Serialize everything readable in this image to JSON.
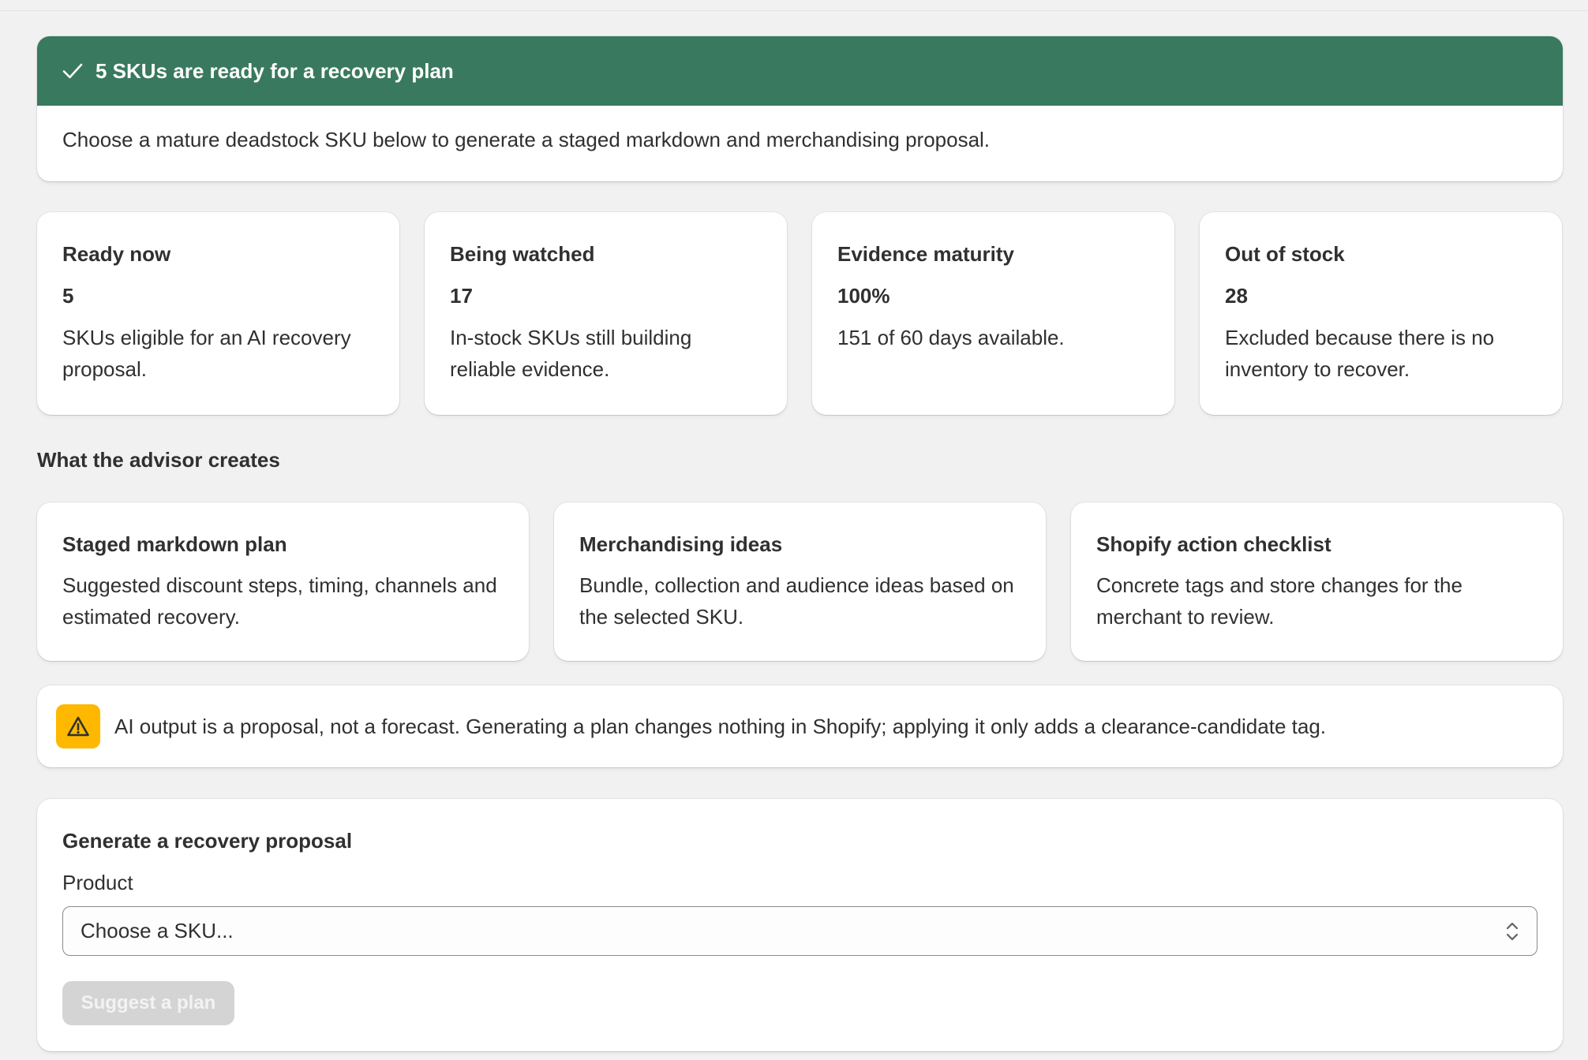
{
  "banner": {
    "icon": "checkmark-icon",
    "title": "5 SKUs are ready for a recovery plan",
    "body": "Choose a mature deadstock SKU below to generate a staged markdown and merchandising proposal.",
    "color": "#39795f"
  },
  "stats": [
    {
      "heading": "Ready now",
      "value": "5",
      "description": "SKUs eligible for an AI recovery proposal."
    },
    {
      "heading": "Being watched",
      "value": "17",
      "description": "In-stock SKUs still building reliable evidence."
    },
    {
      "heading": "Evidence maturity",
      "value": "100%",
      "description": "151 of 60 days available."
    },
    {
      "heading": "Out of stock",
      "value": "28",
      "description": "Excluded because there is no inventory to recover."
    }
  ],
  "advisor": {
    "title": "What the advisor creates",
    "features": [
      {
        "heading": "Staged markdown plan",
        "description": "Suggested discount steps, timing, channels and estimated recovery."
      },
      {
        "heading": "Merchandising ideas",
        "description": "Bundle, collection and audience ideas based on the selected SKU."
      },
      {
        "heading": "Shopify action checklist",
        "description": "Concrete tags and store changes for the merchant to review."
      }
    ]
  },
  "notice": {
    "icon": "warning-icon",
    "text": "AI output is a proposal, not a forecast. Generating a plan changes nothing in Shopify; applying it only adds a clearance-candidate tag.",
    "color": "#ffb800"
  },
  "form": {
    "title": "Generate a recovery proposal",
    "product_label": "Product",
    "select_value": "Choose a SKU...",
    "submit_label": "Suggest a plan"
  }
}
